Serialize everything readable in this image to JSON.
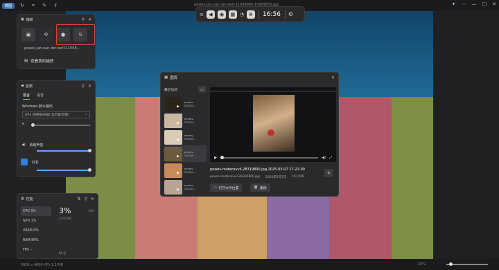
{
  "topbar": {
    "brand": "截图",
    "filename": "pexels-jan-van-der-wolf-11568905-15609833.jpg"
  },
  "gamebar": {
    "time": "16:56"
  },
  "capture": {
    "title": "捕获",
    "filename": "pexels-jan-van-der-wolf-11568…",
    "link": "查看我的捕获"
  },
  "audio": {
    "title": "音频",
    "tabs": [
      "混合",
      "语音"
    ],
    "section": "Windows 默认输出",
    "device": "DP3 (网络扬声器) 显示器(音频)",
    "mixer": [
      {
        "name": "系统声音"
      },
      {
        "name": "钉钉"
      }
    ]
  },
  "performance": {
    "title": "性能",
    "items": [
      "CPU 3%",
      "GPU 1%",
      "VRAM 0%",
      "RAM 86%",
      "FPS --"
    ],
    "big_value": "3%",
    "freq": "3.19 GHz",
    "max_label": "100",
    "bottom_label": "60 秒"
  },
  "gallery": {
    "title": "图库",
    "recent_label": "最近访问",
    "thumbs": [
      {
        "name": "pexels-",
        "date": "2025/5..."
      },
      {
        "name": "pexels-",
        "date": "2025/5..."
      },
      {
        "name": "pexels-",
        "date": "2025/5..."
      },
      {
        "name": "pexels-",
        "date": "2025/5..."
      },
      {
        "name": "pexels-",
        "date": "2025/4..."
      },
      {
        "name": "pexels-",
        "date": "2024/1..."
      }
    ],
    "video_title": "pexels-mutecevvil-28319890.jpg  2025-05-07 17-22-00",
    "file_meta": "pexels-mutecevvil-28319890.jpg",
    "date_meta": "2025年5月7日",
    "size_meta": "19.0 MB",
    "open_location": "打开文件位置",
    "delete": "删除"
  },
  "bottombar": {
    "left_text": "3000 x 4000 (中) 1.5 MB",
    "zoom": "24%"
  }
}
